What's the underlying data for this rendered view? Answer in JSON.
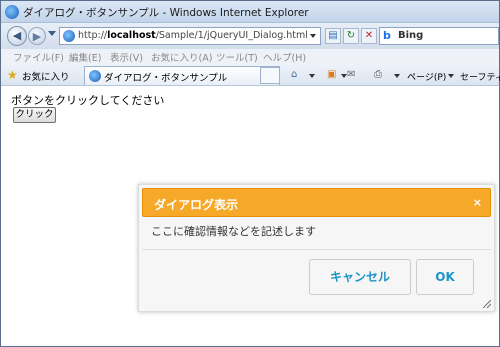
{
  "window": {
    "title": "ダイアログ・ボタンサンプル - Windows Internet Explorer"
  },
  "address": {
    "url_prefix": "http://",
    "url_host": "localhost",
    "url_path": "/Sample/1/jQueryUI_Dialog.html"
  },
  "search": {
    "provider": "Bing"
  },
  "menu": {
    "items": [
      "ファイル(F)",
      "編集(E)",
      "表示(V)",
      "お気に入り(A)",
      "ツール(T)",
      "ヘルプ(H)"
    ]
  },
  "favorites": {
    "label": "お気に入り",
    "tab_label": "ダイアログ・ボタンサンプル",
    "page_menu": "ページ(P)",
    "safety_menu": "セーフティ"
  },
  "page": {
    "prompt": "ボタンをクリックしてください",
    "click_button": "クリック"
  },
  "dialog": {
    "title": "ダイアログ表示",
    "close_symbol": "×",
    "message": "ここに確認情報などを記述します",
    "cancel_label": "キャンセル",
    "ok_label": "OK"
  },
  "colors": {
    "dialog_header": "#f6a828",
    "dialog_button_text": "#1c94c4"
  }
}
